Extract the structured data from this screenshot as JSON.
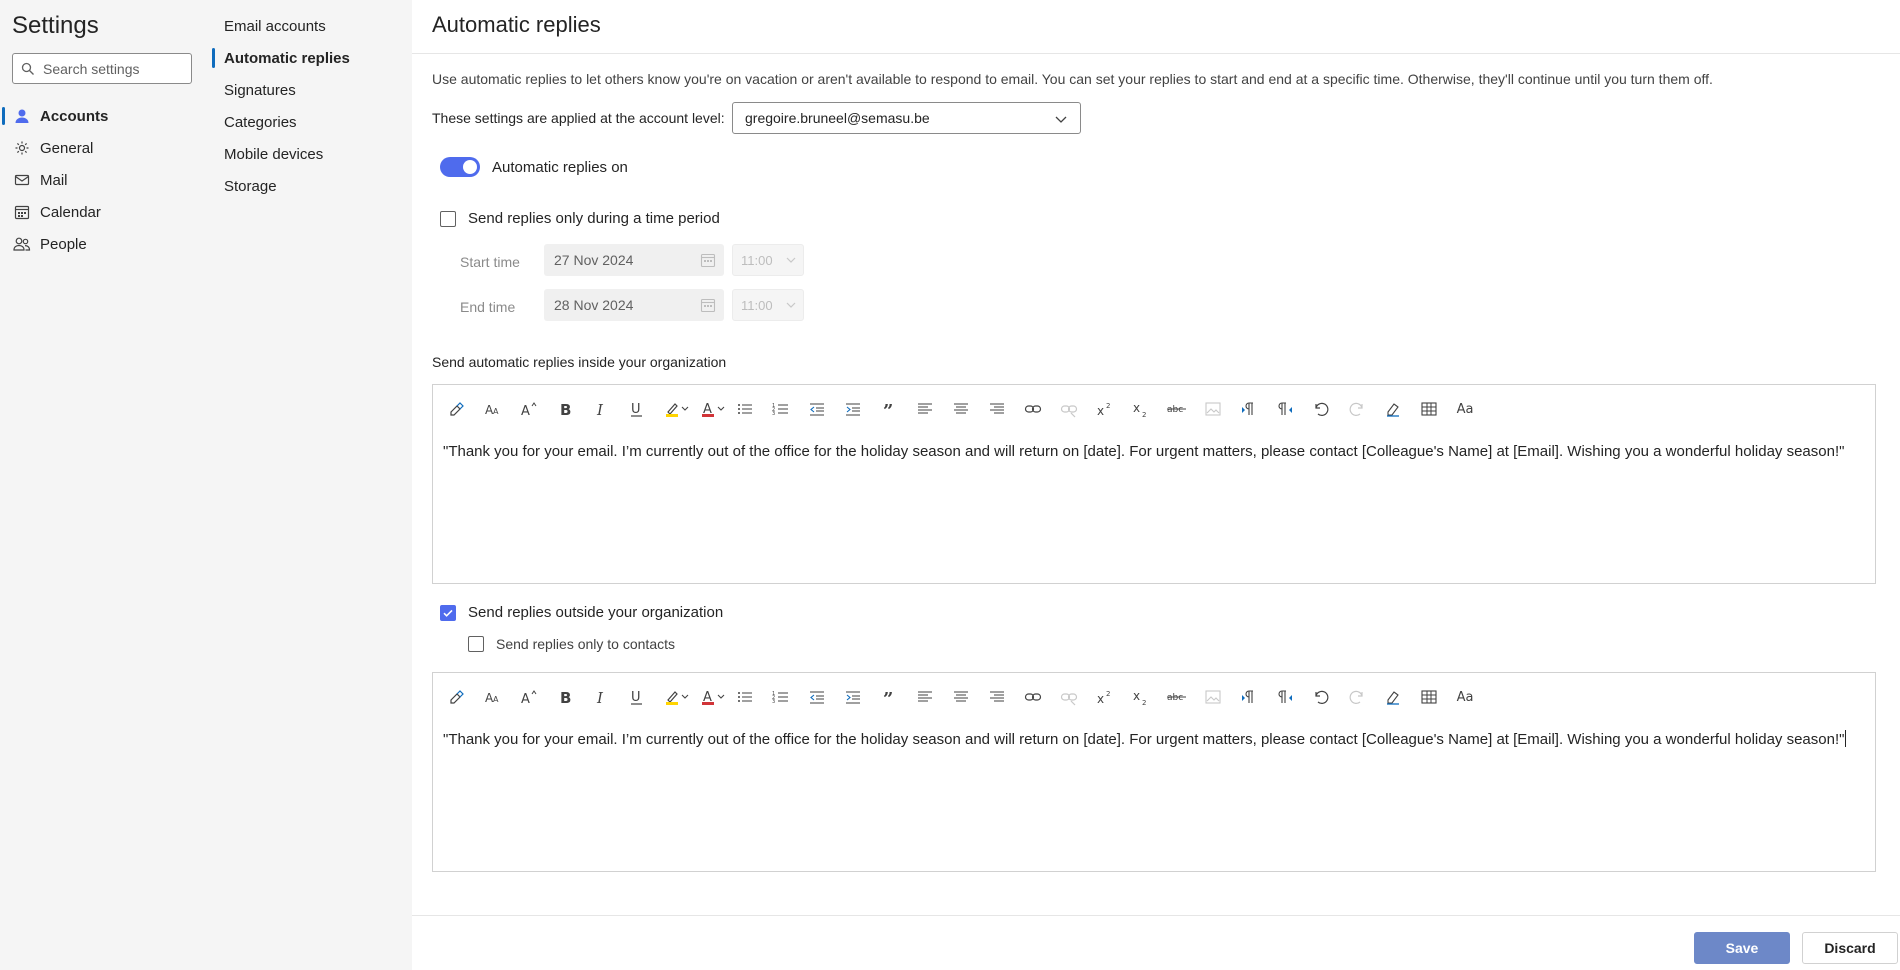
{
  "app": {
    "title": "Settings"
  },
  "search": {
    "placeholder": "Search settings"
  },
  "nav": {
    "items": [
      {
        "label": "Accounts",
        "icon": "person-icon"
      },
      {
        "label": "General",
        "icon": "gear-icon"
      },
      {
        "label": "Mail",
        "icon": "mail-icon"
      },
      {
        "label": "Calendar",
        "icon": "calendar-icon"
      },
      {
        "label": "People",
        "icon": "people-icon"
      }
    ],
    "active": "Accounts"
  },
  "subnav": {
    "items": [
      "Email accounts",
      "Automatic replies",
      "Signatures",
      "Categories",
      "Mobile devices",
      "Storage"
    ],
    "active": "Automatic replies"
  },
  "page": {
    "title": "Automatic replies",
    "description": "Use automatic replies to let others know you're on vacation or aren't available to respond to email. You can set your replies to start and end at a specific time. Otherwise, they'll continue until you turn them off.",
    "account_label": "These settings are applied at the account level:",
    "account_value": "gregoire.bruneel@semasu.be",
    "toggle_label": "Automatic replies on",
    "toggle_on": true,
    "time_period_label": "Send replies only during a time period",
    "time_period_checked": false,
    "start_label": "Start time",
    "start_date": "27 Nov 2024",
    "start_time": "11:00",
    "end_label": "End time",
    "end_date": "28 Nov 2024",
    "end_time": "11:00",
    "inside_label": "Send automatic replies inside your organization",
    "inside_message": "\"Thank you for your email. I’m currently out of the office for the holiday season and will return on [date]. For urgent matters, please contact [Colleague's Name] at [Email]. Wishing you a wonderful holiday season!\"",
    "outside_label": "Send replies outside your organization",
    "outside_checked": true,
    "contacts_only_label": "Send replies only to contacts",
    "contacts_only_checked": false,
    "outside_message": "\"Thank you for your email. I’m currently out of the office for the holiday season and will return on [date]. For urgent matters, please contact [Colleague's Name] at [Email]. Wishing you a wonderful holiday season!\""
  },
  "toolbar": {
    "font_size_glyph": "Aa",
    "tools": [
      "format-painter-icon",
      "font-size-icon",
      "grow-font-icon",
      "bold-icon",
      "italic-icon",
      "underline-icon",
      "highlight-icon",
      "font-color-icon",
      "bullets-icon",
      "numbering-icon",
      "decrease-indent-icon",
      "increase-indent-icon",
      "quote-icon",
      "align-left-icon",
      "align-center-icon",
      "align-right-icon",
      "link-icon",
      "unlink-icon",
      "superscript-icon",
      "subscript-icon",
      "strikethrough-icon",
      "insert-image-icon",
      "ltr-icon",
      "rtl-icon",
      "undo-icon",
      "redo-icon",
      "clear-format-icon",
      "table-icon",
      "change-case-icon"
    ]
  },
  "footer": {
    "save_label": "Save",
    "discard_label": "Discard"
  },
  "colors": {
    "accent": "#4f6bed",
    "save_button": "#6d88c8",
    "nav_background": "#f5f5f5"
  }
}
